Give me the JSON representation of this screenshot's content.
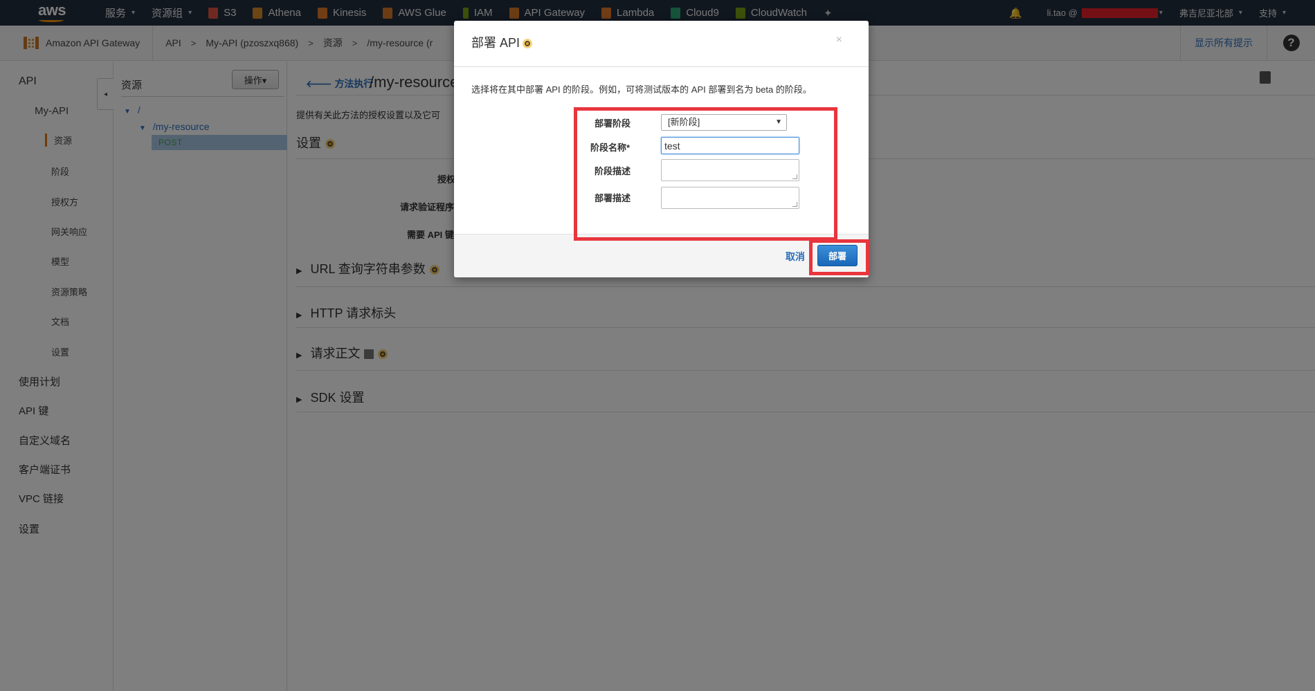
{
  "topnav": {
    "logo": "aws",
    "services": "服务",
    "resource_groups": "资源组",
    "shortcuts": [
      {
        "label": "S3",
        "color": "#e05243"
      },
      {
        "label": "Athena",
        "color": "#d98b2b"
      },
      {
        "label": "Kinesis",
        "color": "#e07b2b"
      },
      {
        "label": "AWS Glue",
        "color": "#d9782b"
      },
      {
        "label": "IAM",
        "color": "#7aa116"
      },
      {
        "label": "API Gateway",
        "color": "#d67b2a"
      },
      {
        "label": "Lambda",
        "color": "#e07b2b"
      },
      {
        "label": "Cloud9",
        "color": "#2aa876"
      },
      {
        "label": "CloudWatch",
        "color": "#7aa116"
      }
    ],
    "account": "li.tao @",
    "region": "弗吉尼亚北部",
    "support": "支持"
  },
  "breadcrumb": {
    "product": "Amazon API Gateway",
    "items": [
      "API",
      "My-API (pzoszxq868)",
      "资源",
      "/my-resource (r"
    ],
    "show_hints": "显示所有提示",
    "help": "?"
  },
  "leftnav": {
    "api": "API",
    "my_api": "My-API",
    "sub_items": [
      "资源",
      "阶段",
      "授权方",
      "网关响应",
      "模型",
      "资源策略",
      "文档",
      "设置"
    ],
    "bottom_items": [
      "使用计划",
      "API 键",
      "自定义域名",
      "客户端证书",
      "VPC 链接",
      "设置"
    ]
  },
  "resources": {
    "title": "资源",
    "actions": "操作▾",
    "root": "/",
    "child": "/my-resource",
    "method": "POST"
  },
  "main": {
    "back": "方法执行",
    "title": "/my-resource",
    "desc": "提供有关此方法的授权设置以及它可",
    "settings": "设置",
    "fields": [
      "授权",
      "请求验证程序",
      "需要 API 键"
    ],
    "sections": [
      "URL 查询字符串参数",
      "HTTP 请求标头",
      "请求正文",
      "SDK 设置"
    ]
  },
  "modal": {
    "title": "部署 API",
    "close": "×",
    "desc": "选择将在其中部署 API 的阶段。例如，可将测试版本的 API 部署到名为 beta 的阶段。",
    "stage_label": "部署阶段",
    "stage_value": "[新阶段]",
    "name_label": "阶段名称*",
    "name_value": "test",
    "stage_desc_label": "阶段描述",
    "deploy_desc_label": "部署描述",
    "cancel": "取消",
    "deploy": "部署"
  }
}
